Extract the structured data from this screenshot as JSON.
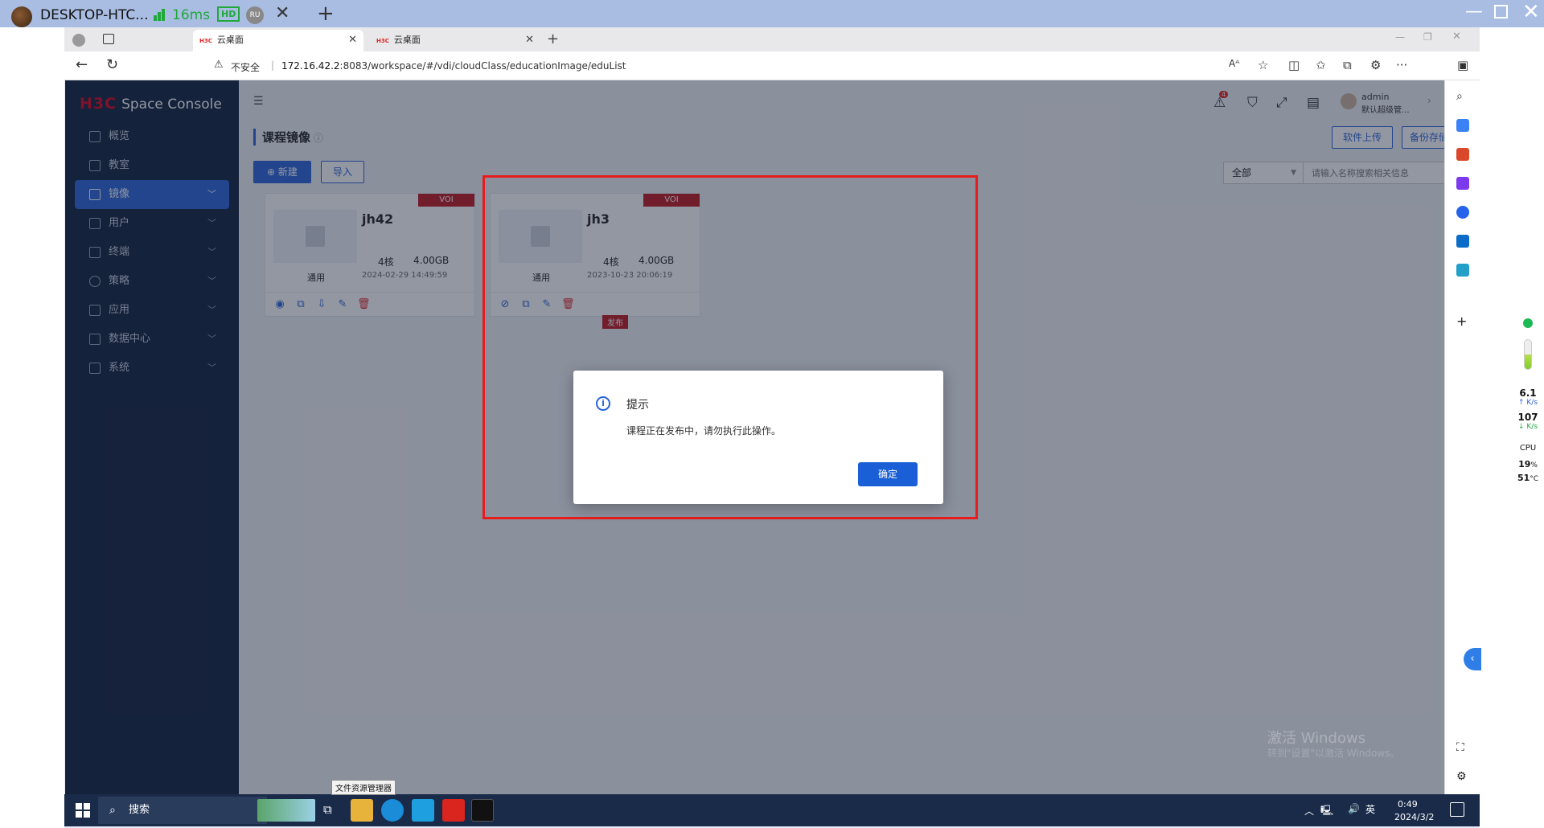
{
  "remote_bar": {
    "title": "DESKTOP-HTC...",
    "ping": "16ms",
    "hd_label": "HD",
    "lang_badge": "RU"
  },
  "browser": {
    "tabs": [
      {
        "label": "云桌面",
        "active": true
      },
      {
        "label": "云桌面",
        "active": false
      }
    ],
    "security_label": "不安全",
    "url_host": "172.16.42.2",
    "url_rest": ":8083/workspace/#/vdi/cloudClass/educationImage/eduList"
  },
  "app": {
    "brand_logo": "H3C",
    "brand_name": "Space Console",
    "menu": [
      {
        "label": "概览",
        "expandable": false,
        "active": false
      },
      {
        "label": "教室",
        "expandable": false,
        "active": false
      },
      {
        "label": "镜像",
        "expandable": true,
        "active": true
      },
      {
        "label": "用户",
        "expandable": true,
        "active": false
      },
      {
        "label": "终端",
        "expandable": true,
        "active": false
      },
      {
        "label": "策略",
        "expandable": true,
        "active": false
      },
      {
        "label": "应用",
        "expandable": true,
        "active": false
      },
      {
        "label": "数据中心",
        "expandable": true,
        "active": false
      },
      {
        "label": "系统",
        "expandable": true,
        "active": false
      }
    ],
    "header": {
      "alert_count": "4",
      "user_name": "admin",
      "user_role": "默认超级管..."
    },
    "page_title": "课程镜像",
    "buttons": {
      "new": "新建",
      "import": "导入",
      "upload": "软件上传",
      "backup": "备份存储地设置"
    },
    "filter": {
      "selected": "全部",
      "search_placeholder": "请输入名称搜索相关信息"
    },
    "cards": [
      {
        "name": "jh42",
        "badge": "VOI",
        "cores": "4核",
        "memory": "4.00GB",
        "type": "通用",
        "date": "2024-02-29 14:49:59"
      },
      {
        "name": "jh3",
        "badge": "VOI",
        "cores": "4核",
        "memory": "4.00GB",
        "type": "通用",
        "date": "2023-10-23 20:06:19"
      }
    ],
    "publish_tag": "发布"
  },
  "dialog": {
    "title": "提示",
    "message": "课程正在发布中，请勿执行此操作。",
    "ok": "确定"
  },
  "watermark": {
    "line1": "激活 Windows",
    "line2": "转到\"设置\"以激活 Windows。"
  },
  "net_widget": {
    "up_value": "6.1",
    "up_unit": "K/s",
    "down_value": "107",
    "down_unit": "K/s",
    "cpu_label": "CPU",
    "cpu_percent": "19",
    "cpu_percent_unit": "%",
    "temp_value": "51",
    "temp_unit": "°C"
  },
  "taskbar": {
    "search_label": "搜索",
    "tooltip": "文件资源管理器",
    "tray_lang": "英",
    "time": "0:49",
    "date": "2024/3/2"
  },
  "colors": {
    "accent": "#2763d6",
    "sidebar_bg": "#0f1f3a",
    "badge_red": "#c0161b",
    "highlight_red": "#e81c1c"
  }
}
